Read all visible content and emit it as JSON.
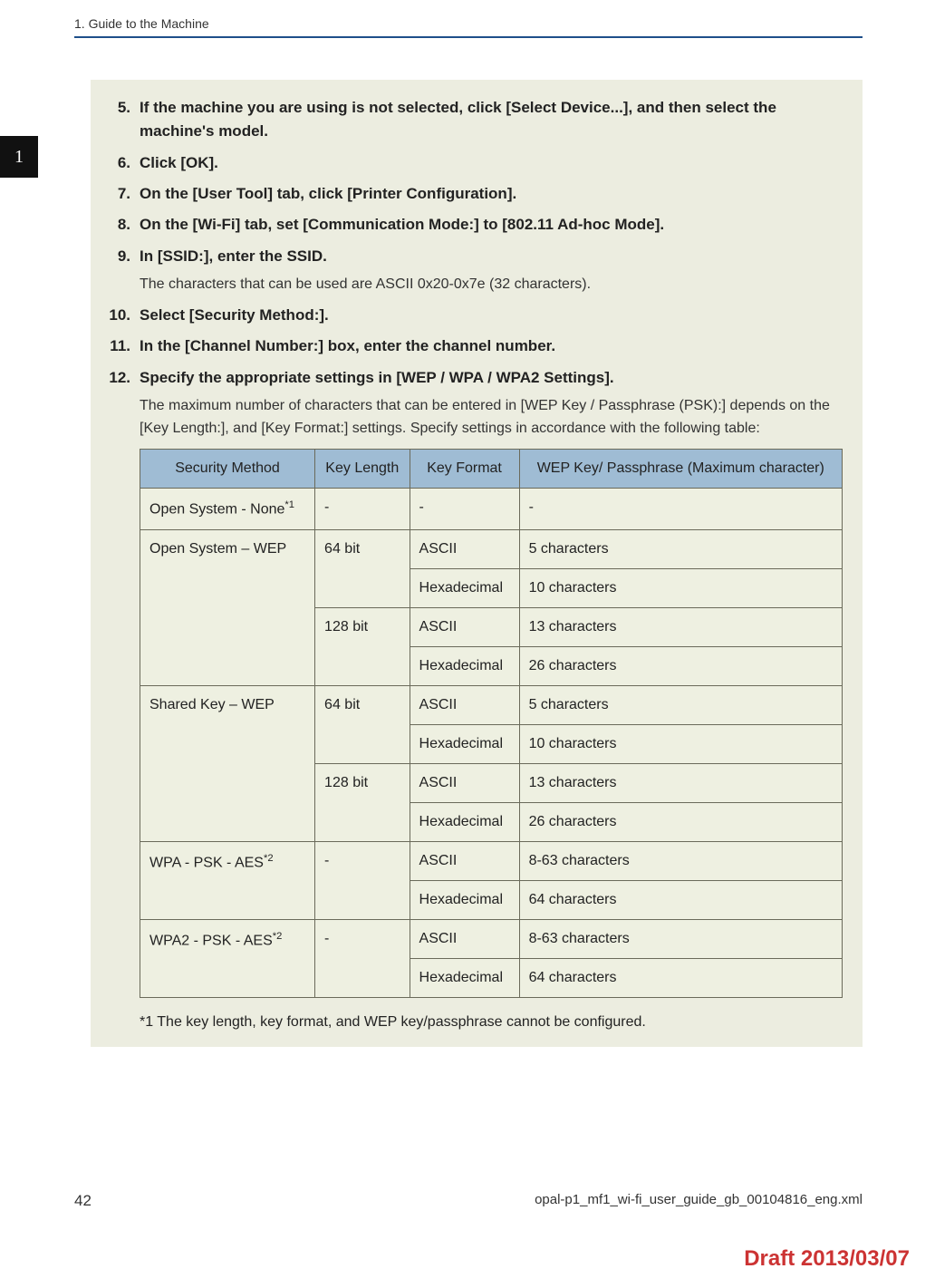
{
  "running_head": "1. Guide to the Machine",
  "side_tab": "1",
  "steps": [
    {
      "n": "5.",
      "instr": "If the machine you are using is not selected, click [Select Device...], and then select the machine's model."
    },
    {
      "n": "6.",
      "instr": "Click [OK]."
    },
    {
      "n": "7.",
      "instr": "On the [User Tool] tab, click [Printer Configuration]."
    },
    {
      "n": "8.",
      "instr": "On the [Wi-Fi] tab, set [Communication Mode:] to [802.11 Ad-hoc Mode]."
    },
    {
      "n": "9.",
      "instr": "In [SSID:], enter the SSID.",
      "note": "The characters that can be used are ASCII 0x20-0x7e (32 characters)."
    },
    {
      "n": "10.",
      "instr": "Select [Security Method:]."
    },
    {
      "n": "11.",
      "instr": "In the [Channel Number:] box, enter the channel number."
    },
    {
      "n": "12.",
      "instr": "Specify the appropriate settings in [WEP / WPA / WPA2 Settings].",
      "note": "The maximum number of characters that can be entered in [WEP Key / Passphrase (PSK):] depends on the [Key Length:], and [Key Format:] settings. Specify settings in accordance with the following table:"
    }
  ],
  "table": {
    "headers": [
      "Security Method",
      "Key Length",
      "Key Format",
      "WEP Key/ Passphrase (Maximum character)"
    ],
    "rows": [
      {
        "method": "Open System - None",
        "sup": "*1",
        "length": "-",
        "format": "-",
        "max": "-"
      },
      {
        "method": "Open System – WEP",
        "rows": [
          {
            "length": "64 bit",
            "sub": [
              {
                "format": "ASCII",
                "max": "5 characters"
              },
              {
                "format": "Hexadecimal",
                "max": "10 characters"
              }
            ]
          },
          {
            "length": "128 bit",
            "sub": [
              {
                "format": "ASCII",
                "max": "13 characters"
              },
              {
                "format": "Hexadecimal",
                "max": "26 characters"
              }
            ]
          }
        ]
      },
      {
        "method": "Shared Key – WEP",
        "rows": [
          {
            "length": "64 bit",
            "sub": [
              {
                "format": "ASCII",
                "max": "5 characters"
              },
              {
                "format": "Hexadecimal",
                "max": "10 characters"
              }
            ]
          },
          {
            "length": "128 bit",
            "sub": [
              {
                "format": "ASCII",
                "max": "13 characters"
              },
              {
                "format": "Hexadecimal",
                "max": "26 characters"
              }
            ]
          }
        ]
      },
      {
        "method": "WPA - PSK - AES",
        "sup": "*2",
        "length": "-",
        "sub": [
          {
            "format": "ASCII",
            "max": "8-63 characters"
          },
          {
            "format": "Hexadecimal",
            "max": "64 characters"
          }
        ]
      },
      {
        "method": "WPA2 - PSK - AES",
        "sup": "*2",
        "length": "-",
        "sub": [
          {
            "format": "ASCII",
            "max": "8-63 characters"
          },
          {
            "format": "Hexadecimal",
            "max": "64 characters"
          }
        ]
      }
    ]
  },
  "footnote": "*1 The key length, key format, and WEP key/passphrase cannot be configured.",
  "footer": {
    "page": "42",
    "file": "opal-p1_mf1_wi-fi_user_guide_gb_00104816_eng.xml"
  },
  "draft": "Draft 2013/03/07"
}
